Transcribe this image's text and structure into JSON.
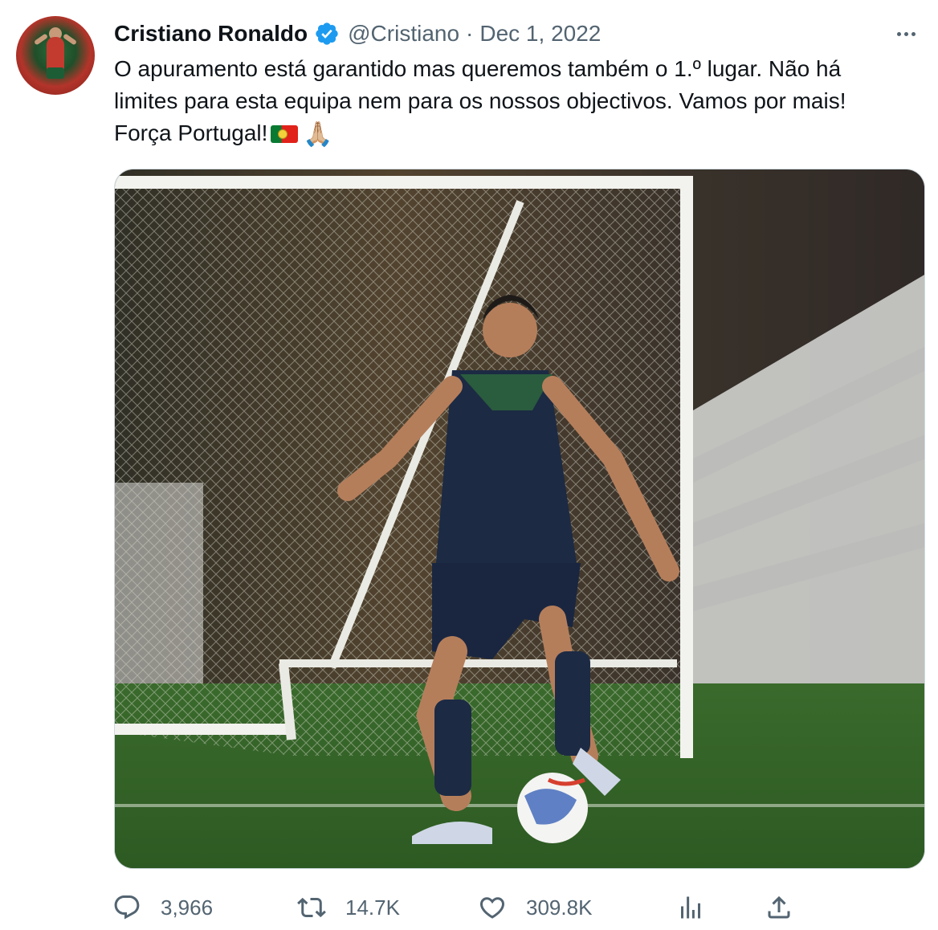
{
  "tweet": {
    "author": {
      "name": "Cristiano Ronaldo",
      "handle": "@Cristiano",
      "verified": true
    },
    "separator": "·",
    "date": "Dec 1, 2022",
    "text_lines": [
      "O apuramento está garantido mas queremos também o 1.º lugar. Não há",
      "limites para esta equipa nem para os nossos objectivos. Vamos por mais!",
      "Força Portugal!"
    ],
    "emoji": {
      "flag": "portugal-flag-icon",
      "pray": "🙏🏼"
    },
    "stats": {
      "replies": "3,966",
      "retweets": "14.7K",
      "likes": "309.8K"
    }
  },
  "colors": {
    "text": "#0f1419",
    "secondary": "#536471",
    "verified": "#1d9bf0",
    "border": "#cfd9de"
  },
  "icons": {
    "verified": "verified-badge-icon",
    "more": "more-options-icon",
    "reply": "reply-icon",
    "retweet": "retweet-icon",
    "like": "heart-icon",
    "views": "analytics-icon",
    "share": "share-icon"
  }
}
